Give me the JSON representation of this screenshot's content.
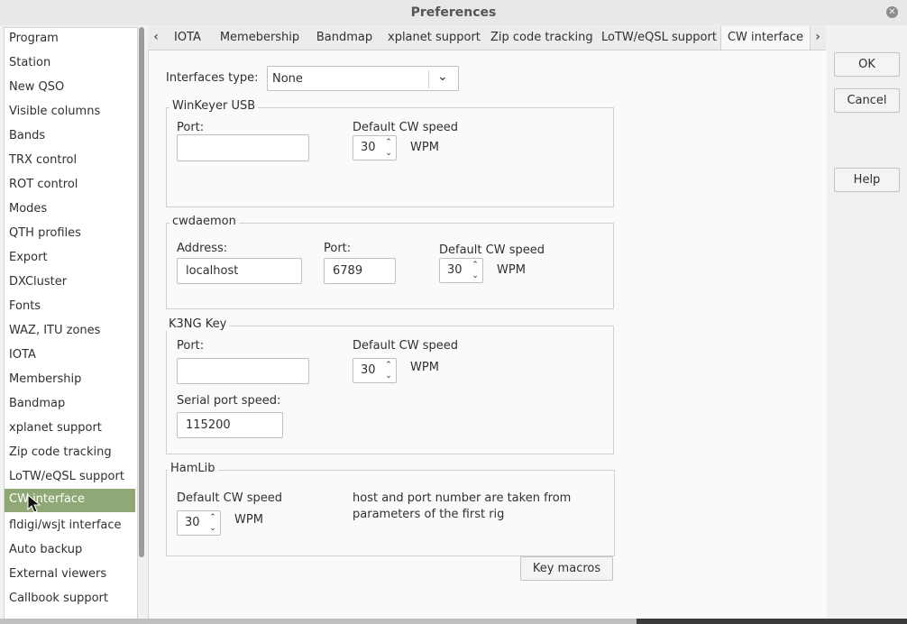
{
  "window": {
    "title": "Preferences"
  },
  "sidebar": {
    "items": [
      {
        "label": "Program"
      },
      {
        "label": "Station"
      },
      {
        "label": "New QSO"
      },
      {
        "label": "Visible columns"
      },
      {
        "label": "Bands"
      },
      {
        "label": "TRX control"
      },
      {
        "label": "ROT control"
      },
      {
        "label": "Modes"
      },
      {
        "label": "QTH profiles"
      },
      {
        "label": "Export"
      },
      {
        "label": "DXCluster"
      },
      {
        "label": "Fonts"
      },
      {
        "label": "WAZ, ITU zones"
      },
      {
        "label": "IOTA"
      },
      {
        "label": "Membership"
      },
      {
        "label": "Bandmap"
      },
      {
        "label": "xplanet support"
      },
      {
        "label": "Zip code tracking"
      },
      {
        "label": "LoTW/eQSL support"
      },
      {
        "label": "CW interface"
      },
      {
        "label": "fldigi/wsjt interface"
      },
      {
        "label": "Auto backup"
      },
      {
        "label": "External viewers"
      },
      {
        "label": "Callbook support"
      }
    ],
    "selected": "CW interface"
  },
  "tabs": [
    {
      "label": "IOTA"
    },
    {
      "label": "Memebership"
    },
    {
      "label": "Bandmap"
    },
    {
      "label": "xplanet support"
    },
    {
      "label": "Zip code tracking"
    },
    {
      "label": "LoTW/eQSL support"
    },
    {
      "label": "CW interface"
    }
  ],
  "active_tab": "CW interface",
  "buttons": {
    "ok": "OK",
    "cancel": "Cancel",
    "help": "Help",
    "key_macros": "Key macros"
  },
  "interfaces": {
    "label": "Interfaces type:",
    "value": "None"
  },
  "winkeyer": {
    "title": "WinKeyer USB",
    "port_label": "Port:",
    "port_value": "",
    "speed_label": "Default CW speed",
    "speed_value": "30",
    "unit": "WPM"
  },
  "cwdaemon": {
    "title": "cwdaemon",
    "address_label": "Address:",
    "address_value": "localhost",
    "port_label": "Port:",
    "port_value": "6789",
    "speed_label": "Default CW speed",
    "speed_value": "30",
    "unit": "WPM"
  },
  "k3ng": {
    "title": "K3NG Key",
    "port_label": "Port:",
    "port_value": "",
    "speed_label": "Default CW speed",
    "speed_value": "30",
    "unit": "WPM",
    "serial_label": "Serial port speed:",
    "serial_value": "115200"
  },
  "hamlib": {
    "title": "HamLib",
    "speed_label": "Default CW speed",
    "speed_value": "30",
    "unit": "WPM",
    "note_line1": "host and port number are taken from",
    "note_line2": "parameters of the first rig"
  },
  "colors": {
    "selection": "#8fa876",
    "window_bg": "#f1f1f1"
  }
}
